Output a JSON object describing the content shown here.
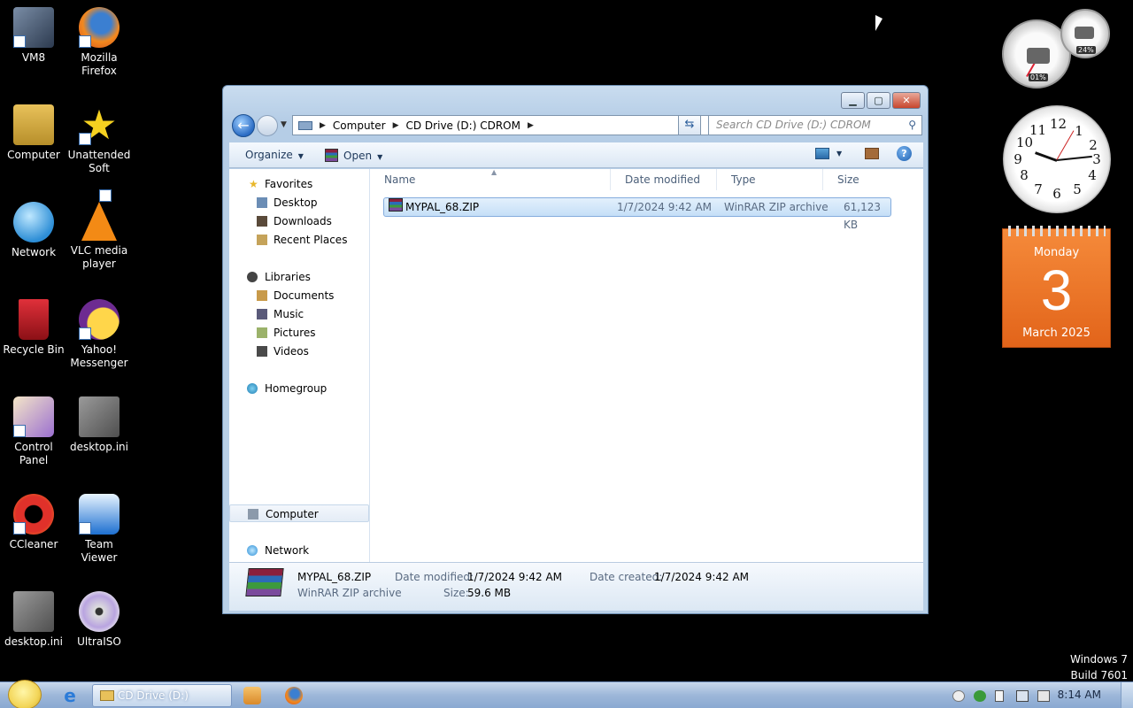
{
  "desktop": {
    "icons": [
      {
        "label": "VM8"
      },
      {
        "label": "Mozilla Firefox"
      },
      {
        "label": "Computer"
      },
      {
        "label": "Unattended Soft"
      },
      {
        "label": "Network"
      },
      {
        "label": "VLC media player"
      },
      {
        "label": "Recycle Bin"
      },
      {
        "label": "Yahoo! Messenger"
      },
      {
        "label": "Control Panel"
      },
      {
        "label": "desktop.ini"
      },
      {
        "label": "CCleaner"
      },
      {
        "label": "Team Viewer"
      },
      {
        "label": "desktop.ini"
      },
      {
        "label": "UltraISO"
      }
    ],
    "watermark": {
      "line1": "Windows 7",
      "line2": "Build 7601"
    }
  },
  "gadgets": {
    "cpu_meter": {
      "cpu": "01%",
      "memory": "24%"
    },
    "clock_numbers": [
      "12",
      "1",
      "2",
      "3",
      "4",
      "5",
      "6",
      "7",
      "8",
      "9",
      "10",
      "11"
    ],
    "calendar": {
      "day_name": "Monday",
      "day": "3",
      "month_year": "March 2025"
    }
  },
  "window": {
    "address": {
      "root_arrow": "▶",
      "segments": [
        "Computer",
        "CD Drive (D:) CDROM"
      ]
    },
    "search_placeholder": "Search CD Drive (D:) CDROM",
    "toolbar": {
      "organize": "Organize",
      "open": "Open"
    },
    "nav": {
      "favorites": "Favorites",
      "desktop": "Desktop",
      "downloads": "Downloads",
      "recent": "Recent Places",
      "libraries": "Libraries",
      "documents": "Documents",
      "music": "Music",
      "pictures": "Pictures",
      "videos": "Videos",
      "homegroup": "Homegroup",
      "computer": "Computer",
      "network": "Network"
    },
    "columns": {
      "name": "Name",
      "date": "Date modified",
      "type": "Type",
      "size": "Size"
    },
    "files": [
      {
        "name": "MYPAL_68.ZIP",
        "date": "1/7/2024 9:42 AM",
        "type": "WinRAR ZIP archive",
        "size": "61,123 KB"
      }
    ],
    "details": {
      "name": "MYPAL_68.ZIP",
      "type": "WinRAR ZIP archive",
      "modified_label": "Date modified:",
      "modified_value": "1/7/2024 9:42 AM",
      "size_label": "Size:",
      "size_value": "59.6 MB",
      "created_label": "Date created:",
      "created_value": "1/7/2024 9:42 AM"
    }
  },
  "taskbar": {
    "task_label": "CD Drive (D:) CDROM",
    "time": "8:14 AM"
  },
  "colors": {
    "accent": "#2b6cc4",
    "calendar": "#f07a28"
  }
}
